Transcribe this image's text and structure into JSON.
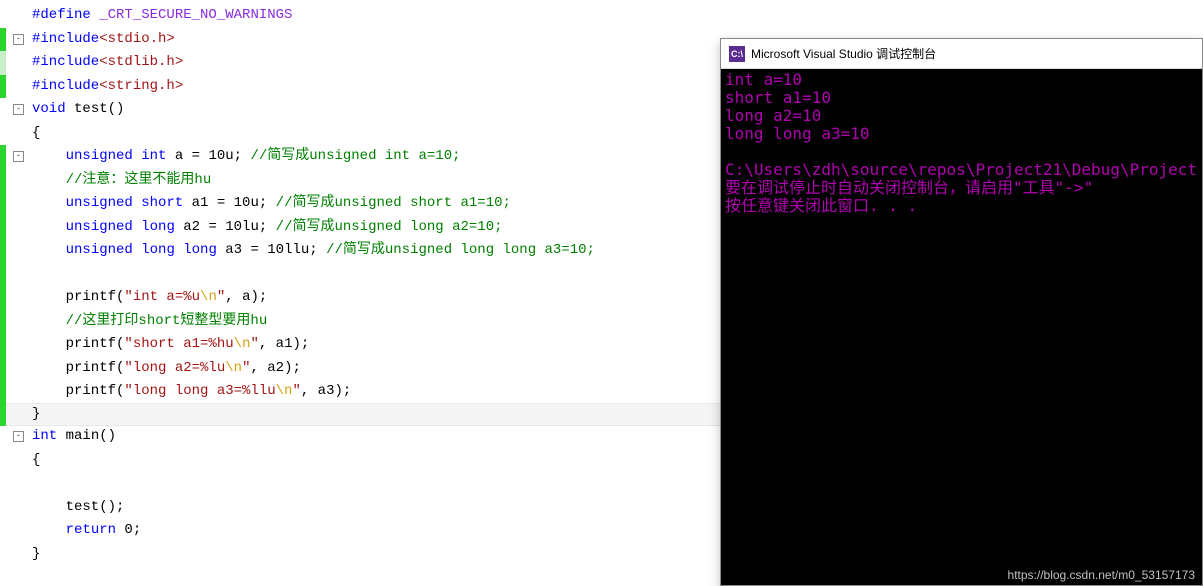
{
  "editor": {
    "lines": [
      {
        "fold": null,
        "mark": null,
        "tokens": [
          {
            "t": "",
            "c": "punct"
          },
          {
            "t": "#define",
            "c": "kw"
          },
          {
            "t": " ",
            "c": "punct"
          },
          {
            "t": "_CRT_SECURE_NO_WARNINGS",
            "c": "macro"
          }
        ]
      },
      {
        "fold": "-",
        "mark": "mark",
        "tokens": [
          {
            "t": "#include",
            "c": "kw"
          },
          {
            "t": "<stdio.h>",
            "c": "inc"
          }
        ]
      },
      {
        "fold": null,
        "mark": "mark light",
        "tokens": [
          {
            "t": "#include",
            "c": "kw"
          },
          {
            "t": "<stdlib.h>",
            "c": "inc"
          }
        ]
      },
      {
        "fold": null,
        "mark": "mark",
        "tokens": [
          {
            "t": "#include",
            "c": "kw"
          },
          {
            "t": "<string.h>",
            "c": "inc"
          }
        ]
      },
      {
        "fold": "-",
        "mark": null,
        "tokens": [
          {
            "t": "void",
            "c": "kw"
          },
          {
            "t": " test()",
            "c": "ident"
          }
        ]
      },
      {
        "fold": null,
        "mark": null,
        "tokens": [
          {
            "t": "{",
            "c": "punct"
          }
        ]
      },
      {
        "fold": "-",
        "mark": "mark",
        "tokens": [
          {
            "t": "    ",
            "c": "punct"
          },
          {
            "t": "unsigned",
            "c": "kw"
          },
          {
            "t": " ",
            "c": "punct"
          },
          {
            "t": "int",
            "c": "kw"
          },
          {
            "t": " a = 10u; ",
            "c": "ident"
          },
          {
            "t": "//简写成unsigned int a=10;",
            "c": "comment"
          }
        ]
      },
      {
        "fold": null,
        "mark": "mark",
        "tokens": [
          {
            "t": "    ",
            "c": "punct"
          },
          {
            "t": "//注意：这里不能用hu",
            "c": "comment"
          }
        ]
      },
      {
        "fold": null,
        "mark": "mark",
        "tokens": [
          {
            "t": "    ",
            "c": "punct"
          },
          {
            "t": "unsigned",
            "c": "kw"
          },
          {
            "t": " ",
            "c": "punct"
          },
          {
            "t": "short",
            "c": "kw"
          },
          {
            "t": " a1 = 10u; ",
            "c": "ident"
          },
          {
            "t": "//简写成unsigned short a1=10;",
            "c": "comment"
          }
        ]
      },
      {
        "fold": null,
        "mark": "mark",
        "tokens": [
          {
            "t": "    ",
            "c": "punct"
          },
          {
            "t": "unsigned",
            "c": "kw"
          },
          {
            "t": " ",
            "c": "punct"
          },
          {
            "t": "long",
            "c": "kw"
          },
          {
            "t": " a2 = 10lu; ",
            "c": "ident"
          },
          {
            "t": "//简写成unsigned long a2=10;",
            "c": "comment"
          }
        ]
      },
      {
        "fold": null,
        "mark": "mark",
        "tokens": [
          {
            "t": "    ",
            "c": "punct"
          },
          {
            "t": "unsigned",
            "c": "kw"
          },
          {
            "t": " ",
            "c": "punct"
          },
          {
            "t": "long",
            "c": "kw"
          },
          {
            "t": " ",
            "c": "punct"
          },
          {
            "t": "long",
            "c": "kw"
          },
          {
            "t": " a3 = 10llu; ",
            "c": "ident"
          },
          {
            "t": "//简写成unsigned long long a3=10;",
            "c": "comment"
          }
        ]
      },
      {
        "fold": null,
        "mark": "mark",
        "tokens": [
          {
            "t": "",
            "c": "punct"
          }
        ]
      },
      {
        "fold": null,
        "mark": "mark",
        "tokens": [
          {
            "t": "    printf(",
            "c": "ident"
          },
          {
            "t": "\"int a=%u",
            "c": "str"
          },
          {
            "t": "\\n",
            "c": "esc"
          },
          {
            "t": "\"",
            "c": "str"
          },
          {
            "t": ", a);",
            "c": "ident"
          }
        ]
      },
      {
        "fold": null,
        "mark": "mark",
        "tokens": [
          {
            "t": "    ",
            "c": "punct"
          },
          {
            "t": "//这里打印short短整型要用hu",
            "c": "comment"
          }
        ]
      },
      {
        "fold": null,
        "mark": "mark",
        "tokens": [
          {
            "t": "    printf(",
            "c": "ident"
          },
          {
            "t": "\"short a1=%hu",
            "c": "str"
          },
          {
            "t": "\\n",
            "c": "esc"
          },
          {
            "t": "\"",
            "c": "str"
          },
          {
            "t": ", a1);",
            "c": "ident"
          }
        ]
      },
      {
        "fold": null,
        "mark": "mark",
        "tokens": [
          {
            "t": "    printf(",
            "c": "ident"
          },
          {
            "t": "\"long a2=%lu",
            "c": "str"
          },
          {
            "t": "\\n",
            "c": "esc"
          },
          {
            "t": "\"",
            "c": "str"
          },
          {
            "t": ", a2);",
            "c": "ident"
          }
        ]
      },
      {
        "fold": null,
        "mark": "mark",
        "tokens": [
          {
            "t": "    printf(",
            "c": "ident"
          },
          {
            "t": "\"long long a3=%llu",
            "c": "str"
          },
          {
            "t": "\\n",
            "c": "esc"
          },
          {
            "t": "\"",
            "c": "str"
          },
          {
            "t": ", a3);",
            "c": "ident"
          }
        ]
      },
      {
        "fold": null,
        "mark": "mark",
        "cursor": true,
        "tokens": [
          {
            "t": "}",
            "c": "punct"
          }
        ]
      },
      {
        "fold": "-",
        "mark": null,
        "tokens": [
          {
            "t": "int",
            "c": "kw"
          },
          {
            "t": " main()",
            "c": "ident"
          }
        ]
      },
      {
        "fold": null,
        "mark": null,
        "tokens": [
          {
            "t": "{",
            "c": "punct"
          }
        ]
      },
      {
        "fold": null,
        "mark": null,
        "tokens": [
          {
            "t": "",
            "c": "punct"
          }
        ]
      },
      {
        "fold": null,
        "mark": null,
        "tokens": [
          {
            "t": "    test();",
            "c": "ident"
          }
        ]
      },
      {
        "fold": null,
        "mark": null,
        "tokens": [
          {
            "t": "    ",
            "c": "punct"
          },
          {
            "t": "return",
            "c": "kw"
          },
          {
            "t": " 0;",
            "c": "ident"
          }
        ]
      },
      {
        "fold": null,
        "mark": null,
        "tokens": [
          {
            "t": "}",
            "c": "punct"
          }
        ]
      }
    ]
  },
  "console": {
    "icon_label": "C:\\",
    "title": "Microsoft Visual Studio 调试控制台",
    "output": [
      {
        "text": "int a=10",
        "c": "out-magenta"
      },
      {
        "text": "short a1=10",
        "c": "out-magenta"
      },
      {
        "text": "long a2=10",
        "c": "out-magenta"
      },
      {
        "text": "long long a3=10",
        "c": "out-magenta"
      },
      {
        "text": "",
        "c": "out-magenta"
      },
      {
        "text": "C:\\Users\\zdh\\source\\repos\\Project21\\Debug\\Project",
        "c": "out-magenta"
      },
      {
        "text": "要在调试停止时自动关闭控制台，请启用\"工具\"->\"",
        "c": "out-magenta"
      },
      {
        "text": "按任意键关闭此窗口. . .",
        "c": "out-magenta"
      }
    ]
  },
  "watermark": "https://blog.csdn.net/m0_53157173"
}
